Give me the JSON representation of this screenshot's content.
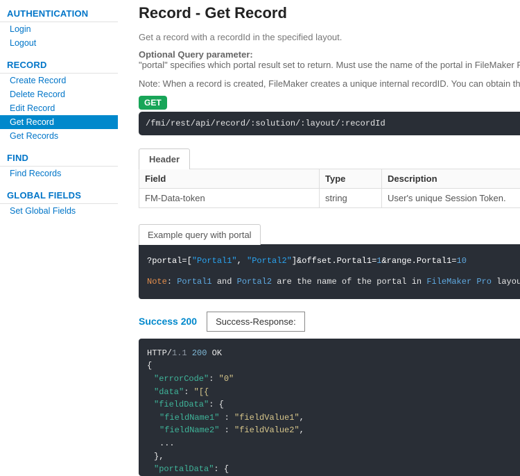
{
  "sidebar": {
    "sections": [
      {
        "heading": "AUTHENTICATION",
        "items": [
          {
            "label": "Login",
            "active": false
          },
          {
            "label": "Logout",
            "active": false
          }
        ]
      },
      {
        "heading": "RECORD",
        "items": [
          {
            "label": "Create Record",
            "active": false
          },
          {
            "label": "Delete Record",
            "active": false
          },
          {
            "label": "Edit Record",
            "active": false
          },
          {
            "label": "Get Record",
            "active": true
          },
          {
            "label": "Get Records",
            "active": false
          }
        ]
      },
      {
        "heading": "FIND",
        "items": [
          {
            "label": "Find Records",
            "active": false
          }
        ]
      },
      {
        "heading": "GLOBAL FIELDS",
        "items": [
          {
            "label": "Set Global Fields",
            "active": false
          }
        ]
      }
    ]
  },
  "page": {
    "title": "Record - Get Record",
    "description": "Get a record with a recordId in the specified layout.",
    "optional_label": "Optional Query parameter:",
    "optional_text": "\"portal\" specifies which portal result set to return. Must use the name of the portal in FileMaker Pro layout i",
    "note": "Note: When a record is created, FileMaker creates a unique internal recordID. You can obtain the value of"
  },
  "endpoint": {
    "method": "GET",
    "path": "/fmi/rest/api/record/:solution/:layout/:recordId"
  },
  "header_tab": "Header",
  "params": {
    "cols": {
      "field": "Field",
      "type": "Type",
      "desc": "Description"
    },
    "rows": [
      {
        "field": "FM-Data-token",
        "type": "string",
        "desc": "User's unique Session Token."
      }
    ]
  },
  "example": {
    "tab": "Example query with portal",
    "query_prefix": "?portal=[",
    "portal1": "\"Portal1\"",
    "sep": ", ",
    "portal2": "\"Portal2\"",
    "query_mid1": "]&offset.Portal1=",
    "val1": "1",
    "query_mid2": "&range.Portal1=",
    "val2": "10",
    "note_label": "Note",
    "note_colon": ": ",
    "note_p1": "Portal1",
    "note_and": " and ",
    "note_p2": "Portal2",
    "note_mid": " are the name of the portal in ",
    "note_fm": "FileMaker Pro",
    "note_end": " layout inspector."
  },
  "success": {
    "label": "Success 200",
    "tab": "Success-Response:"
  },
  "response": {
    "l1a": "HTTP/",
    "l1b": "1.1 ",
    "l1c": "200 ",
    "l1d": "OK",
    "l2": "{",
    "l3k": "\"errorCode\"",
    "l3c": ": ",
    "l3v": "\"0\"",
    "l4k": "\"data\"",
    "l4c": ": ",
    "l4v": "\"[{",
    "l5k": "\"fieldData\"",
    "l5c": ": {",
    "l6k": "\"fieldName1\"",
    "l6c": " : ",
    "l6v": "\"fieldValue1\"",
    "l6e": ",",
    "l7k": "\"fieldName2\"",
    "l7c": " : ",
    "l7v": "\"fieldValue2\"",
    "l7e": ",",
    "l8": "...",
    "l9": "},",
    "l10k": "\"portalData\"",
    "l10c": ": {"
  }
}
